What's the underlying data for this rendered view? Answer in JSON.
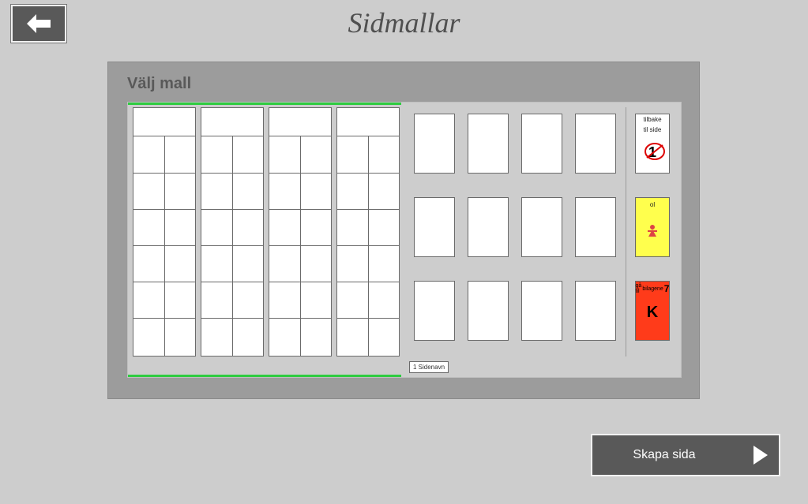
{
  "header": {
    "title": "Sidmallar"
  },
  "panel": {
    "title": "Välj mall"
  },
  "templateA": {
    "sidenavn_label": "1 Sidenavn"
  },
  "sidecards": {
    "back": {
      "line1": "tilbake",
      "line2": "til side",
      "symbol": "1"
    },
    "yellow": {
      "label": "ol"
    },
    "red": {
      "top_small": "gå til",
      "top_small2": "bilagene",
      "top_num": "7",
      "big": "K"
    }
  },
  "buttons": {
    "create": "Skapa sida"
  }
}
